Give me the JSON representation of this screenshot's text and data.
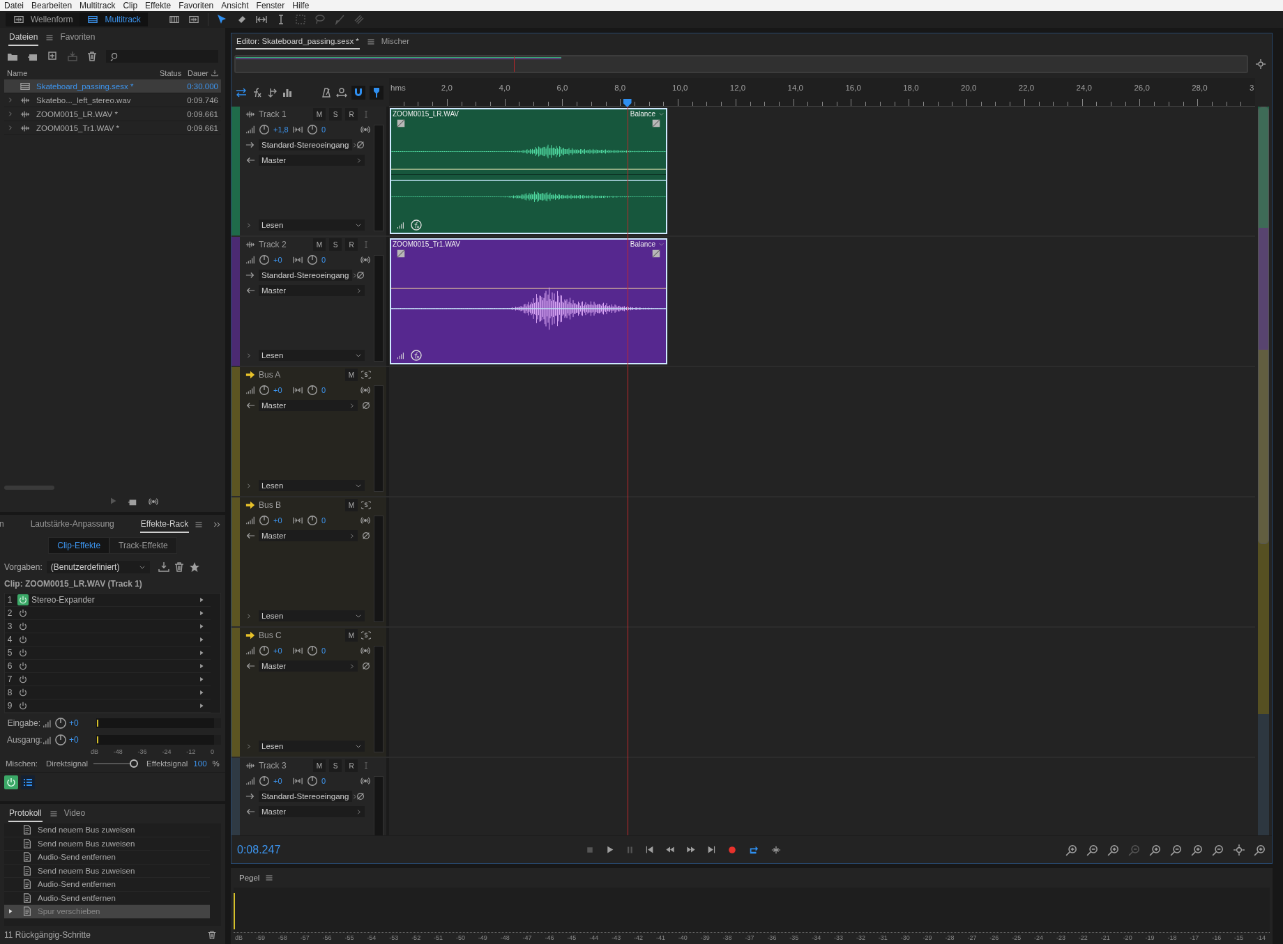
{
  "menu": [
    "Datei",
    "Bearbeiten",
    "Multitrack",
    "Clip",
    "Effekte",
    "Favoriten",
    "Ansicht",
    "Fenster",
    "Hilfe"
  ],
  "workspaces": [
    {
      "label": "Wellenform",
      "selected": false
    },
    {
      "label": "Multitrack",
      "selected": true
    }
  ],
  "files": {
    "tabs": [
      {
        "label": "Dateien",
        "selected": true
      },
      {
        "label": "Favoriten",
        "selected": false
      }
    ],
    "columns": [
      "Name",
      "Status",
      "Dauer"
    ],
    "rows": [
      {
        "kind": "session",
        "name": "Skateboard_passing.sesx *",
        "duration": "0:30.000",
        "selected": true
      },
      {
        "kind": "audio",
        "name": "Skatebo..._left_stereo.wav",
        "duration": "0:09.746",
        "selected": false
      },
      {
        "kind": "audio",
        "name": "ZOOM0015_LR.WAV *",
        "duration": "0:09.661",
        "selected": false
      },
      {
        "kind": "audio",
        "name": "ZOOM0015_Tr1.WAV *",
        "duration": "0:09.661",
        "selected": false
      }
    ]
  },
  "effects": {
    "tabs": [
      {
        "label": "n",
        "selected": false
      },
      {
        "label": "Lautstärke-Anpassung",
        "selected": false
      },
      {
        "label": "Effekte-Rack",
        "selected": true
      }
    ],
    "subtabs": [
      {
        "label": "Clip-Effekte",
        "selected": true
      },
      {
        "label": "Track-Effekte",
        "selected": false
      }
    ],
    "presets_label": "Vorgaben:",
    "preset": "(Benutzerdefiniert)",
    "clip_label": "Clip: ZOOM0015_LR.WAV (Track 1)",
    "slots": [
      {
        "number": "1",
        "name": "Stereo-Expander",
        "on": true
      },
      {
        "number": "2",
        "on": false
      },
      {
        "number": "3",
        "on": false
      },
      {
        "number": "4",
        "on": false
      },
      {
        "number": "5",
        "on": false
      },
      {
        "number": "6",
        "on": false
      },
      {
        "number": "7",
        "on": false
      },
      {
        "number": "8",
        "on": false
      },
      {
        "number": "9",
        "on": false
      }
    ],
    "input": {
      "label": "Eingabe:",
      "value": "+0"
    },
    "output": {
      "label": "Ausgang:",
      "value": "+0"
    },
    "scale": [
      "dB",
      "-48",
      "-36",
      "-24",
      "-12",
      "0"
    ],
    "mix": {
      "label": "Mischen:",
      "dry": "Direktsignal",
      "wet": "Effektsignal",
      "value": "100",
      "unit": "%",
      "level": 1
    },
    "rack_on": true
  },
  "history": {
    "tabs": [
      {
        "label": "Protokoll",
        "selected": true
      },
      {
        "label": "Video",
        "selected": false
      }
    ],
    "items": [
      {
        "label": "Send neuem Bus zuweisen",
        "selected": false
      },
      {
        "label": "Send neuem Bus zuweisen",
        "selected": false
      },
      {
        "label": "Audio-Send entfernen",
        "selected": false
      },
      {
        "label": "Send neuem Bus zuweisen",
        "selected": false
      },
      {
        "label": "Audio-Send entfernen",
        "selected": false
      },
      {
        "label": "Audio-Send entfernen",
        "selected": false
      },
      {
        "label": "Spur verschieben",
        "selected": true
      }
    ],
    "footer": "11 Rückgängig-Schritte"
  },
  "editor": {
    "tabs": [
      {
        "label": "Editor: Skateboard_passing.sesx *",
        "selected": true
      },
      {
        "label": "Mischer",
        "selected": false
      }
    ],
    "playhead": {
      "level": 0.275
    },
    "time": "0:08.247",
    "ruler": {
      "unit": "hms",
      "ticks": [
        "2,0",
        "4,0",
        "6,0",
        "8,0",
        "10,0",
        "12,0",
        "14,0",
        "16,0",
        "18,0",
        "20,0",
        "22,0",
        "24,0",
        "26,0",
        "28,0",
        "3"
      ]
    },
    "tracks": [
      {
        "kind": "audio",
        "name": "Track 1",
        "color": "#1f6b4a",
        "buttons": [
          "M",
          "S",
          "R"
        ],
        "volume": "+1,8",
        "pan": "0",
        "input": "Standard-Stereoeingang",
        "output": "Master",
        "automation": "Lesen",
        "clip": {
          "name": "ZOOM0015_LR.WAV",
          "envelope": "Balance",
          "color": "#17573d",
          "kind": "stereo"
        }
      },
      {
        "kind": "audio",
        "name": "Track 2",
        "color": "#4b2a72",
        "buttons": [
          "M",
          "S",
          "R"
        ],
        "volume": "+0",
        "pan": "0",
        "input": "Standard-Stereoeingang",
        "output": "Master",
        "automation": "Lesen",
        "clip": {
          "name": "ZOOM0015_Tr1.WAV",
          "envelope": "Balance",
          "color": "#56288f",
          "kind": "mono"
        }
      },
      {
        "kind": "bus",
        "name": "Bus A",
        "color": "#5c5522",
        "buttons": [
          "M"
        ],
        "volume": "+0",
        "pan": "0",
        "output": "Master",
        "automation": "Lesen"
      },
      {
        "kind": "bus",
        "name": "Bus B",
        "color": "#5c5522",
        "buttons": [
          "M"
        ],
        "volume": "+0",
        "pan": "0",
        "output": "Master",
        "automation": "Lesen"
      },
      {
        "kind": "bus",
        "name": "Bus C",
        "color": "#5c5522",
        "buttons": [
          "M"
        ],
        "volume": "+0",
        "pan": "0",
        "output": "Master",
        "automation": "Lesen"
      },
      {
        "kind": "audio",
        "name": "Track 3",
        "color": "#2f3a44",
        "buttons": [
          "M",
          "S",
          "R"
        ],
        "volume": "+0",
        "pan": "0",
        "input": "Standard-Stereoeingang",
        "output": "Master"
      }
    ]
  },
  "meter": {
    "title": "Pegel",
    "scale": [
      "dB",
      "-59",
      "-58",
      "-57",
      "-56",
      "-55",
      "-54",
      "-53",
      "-52",
      "-51",
      "-50",
      "-49",
      "-48",
      "-47",
      "-46",
      "-45",
      "-44",
      "-43",
      "-42",
      "-41",
      "-40",
      "-39",
      "-38",
      "-37",
      "-36",
      "-35",
      "-34",
      "-33",
      "-32",
      "-31",
      "-30",
      "-29",
      "-28",
      "-27",
      "-26",
      "-25",
      "-24",
      "-23",
      "-22",
      "-21",
      "-20",
      "-19",
      "-18",
      "-17",
      "-16",
      "-15",
      "-14"
    ]
  }
}
